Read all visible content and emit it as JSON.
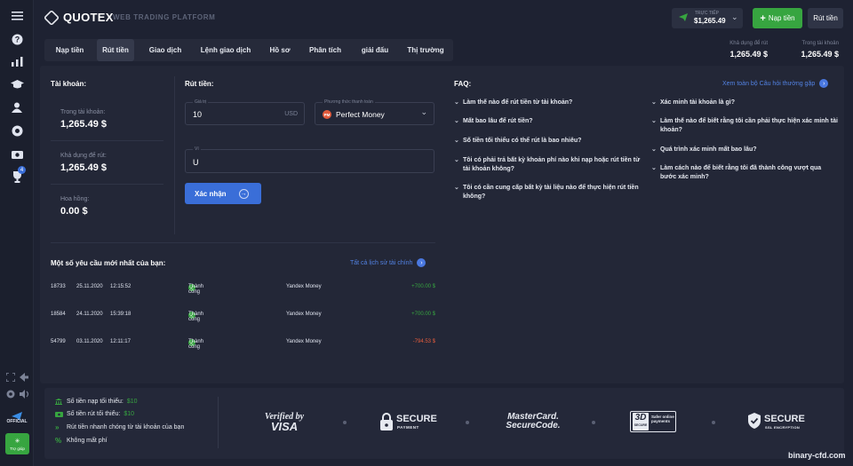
{
  "brand": {
    "name": "QUOTEX",
    "subtitle": "WEB TRADING PLATFORM"
  },
  "account": {
    "mode": "TRỰC TIẾP",
    "balance": "$1,265.49"
  },
  "header_buttons": {
    "deposit": "Nạp tiền",
    "withdraw": "Rút tiền"
  },
  "tabs": [
    "Nạp tiền",
    "Rút tiền",
    "Giao dịch",
    "Lệnh giao dịch",
    "Hồ sơ",
    "Phân tích",
    "giải đấu",
    "Thị trường"
  ],
  "header_stats": [
    {
      "label": "Khả dụng để rút",
      "value": "1,265.49 $"
    },
    {
      "label": "Trong tài khoản",
      "value": "1,265.49 $"
    }
  ],
  "sidebar": {
    "badge": "4",
    "official": "OFFICIAL",
    "help": "Trợ giúp"
  },
  "account_panel": {
    "title": "Tài khoản:",
    "items": [
      {
        "label": "Trong tài khoản:",
        "value": "1,265.49 $"
      },
      {
        "label": "Khả dụng để rút:",
        "value": "1,265.49 $"
      },
      {
        "label": "Hoa hồng:",
        "value": "0.00 $"
      }
    ]
  },
  "withdraw": {
    "title": "Rút tiền:",
    "amount_label": "Giá trị",
    "amount_value": "10",
    "currency": "USD",
    "method_label": "Phương thức thanh toán",
    "method_value": "Perfect Money",
    "method_icon": "PM",
    "wallet_label": "Ví",
    "wallet_value": "U",
    "confirm": "Xác nhận"
  },
  "requests": {
    "title": "Một số yêu cầu mới nhất của bạn:",
    "history_link": "Tất cả lịch sử tài chính",
    "rows": [
      {
        "id": "18733",
        "date": "25.11.2020",
        "time": "12:15:52",
        "status": "Thành công",
        "method": "Yandex Money",
        "amount": "+700.00 $",
        "color": "#37a540"
      },
      {
        "id": "18584",
        "date": "24.11.2020",
        "time": "15:39:18",
        "status": "Thành công",
        "method": "Yandex Money",
        "amount": "+700.00 $",
        "color": "#37a540"
      },
      {
        "id": "54799",
        "date": "03.11.2020",
        "time": "12:11:17",
        "status": "Thành công",
        "method": "Yandex Money",
        "amount": "-794.53 $",
        "color": "#e85d3c"
      }
    ]
  },
  "faq": {
    "title": "FAQ:",
    "all_link": "Xem toàn bộ Câu hỏi thường gặp",
    "left": [
      "Làm thế nào để rút tiền từ tài khoản?",
      "Mất bao lâu để rút tiền?",
      "Số tiền tối thiểu có thể rút là bao nhiêu?",
      "Tôi có phải trả bất kỳ khoản phí nào khi nạp hoặc rút tiền từ tài khoản không?",
      "Tôi có cần cung cấp bất kỳ tài liệu nào để thực hiện rút tiền không?"
    ],
    "right": [
      "Xác minh tài khoản là gì?",
      "Làm thế nào để biết rằng tôi cần phải thực hiện xác minh tài khoản?",
      "Quá trình xác minh mất bao lâu?",
      "Làm cách nào để biết rằng tôi đã thành công vượt qua bước xác minh?"
    ]
  },
  "footer": {
    "items": [
      {
        "text": "Số tiền nạp tối thiểu:",
        "hl": "$10",
        "icon": "bank-icon"
      },
      {
        "text": "Số tiền rút tối thiểu:",
        "hl": "$10",
        "icon": "cash-icon"
      },
      {
        "text": "Rút tiền nhanh chóng từ tài khoản của bạn",
        "hl": "",
        "icon": "double-chevron-icon"
      },
      {
        "text": "Không mất phí",
        "hl": "",
        "icon": "percent-icon"
      }
    ],
    "badges": {
      "visa_top": "Verified by",
      "visa_bottom": "VISA",
      "secure1_top": "SECURE",
      "secure1_bottom": "PAYMENT",
      "mc_top": "MasterCard.",
      "mc_bottom": "SecureCode.",
      "ds_mark": "3D",
      "ds_sub": "SECURE",
      "ds_text": "Safer online payments",
      "ssl_top": "SECURE",
      "ssl_bottom": "SSL ENCRYPTION"
    }
  },
  "watermark": "binary-cfd.com"
}
